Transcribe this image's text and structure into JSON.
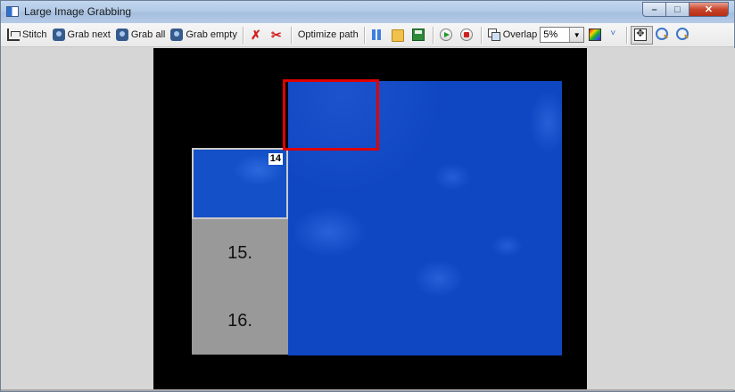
{
  "window": {
    "title": "Large Image Grabbing",
    "buttons": {
      "minimize": "–",
      "maximize": "□",
      "close": "✕"
    }
  },
  "toolbar": {
    "stitch": "Stitch",
    "grab_next": "Grab next",
    "grab_all": "Grab all",
    "grab_empty": "Grab empty",
    "optimize_path": "Optimize path",
    "overlap": "Overlap",
    "overlap_value": "5%",
    "icons": [
      "stitch-icon",
      "camera-icon",
      "camera-all-icon",
      "camera-empty-icon",
      "delete-tiles-icon",
      "delete-all-icon",
      "pause-icon",
      "folder-open-icon",
      "save-icon",
      "play-icon",
      "stop-icon",
      "overlap-icon",
      "color-palette-icon",
      "chevron-down-icon",
      "fit-view-icon",
      "zoom-in-icon",
      "zoom-out-icon"
    ]
  },
  "canvas": {
    "current_tile_label": "14",
    "pending_tiles": [
      {
        "label": "15."
      },
      {
        "label": "16."
      }
    ],
    "colors": {
      "grab_frame": "#e00000",
      "image": "#0f46c2",
      "pending": "#999999",
      "background": "#000000"
    }
  }
}
